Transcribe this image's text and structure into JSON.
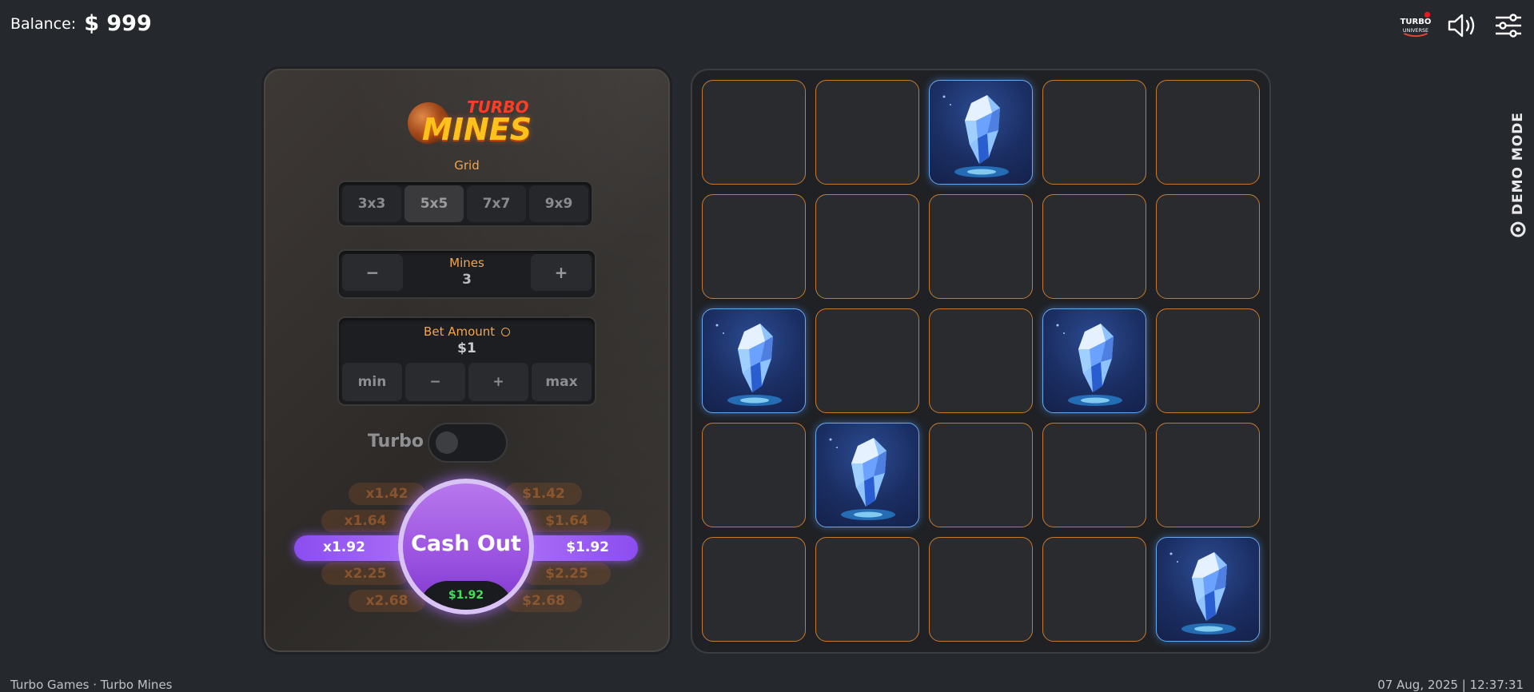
{
  "balance": {
    "label": "Balance:",
    "value": "$ 999"
  },
  "header": {
    "logo_icon": "turbo-universe-logo",
    "sound_icon": "speaker-icon",
    "settings_icon": "sliders-icon"
  },
  "demo_mode": "DEMO MODE",
  "footer": {
    "left": "Turbo Games · Turbo Mines",
    "right": "07 Aug, 2025 | 12:37:31"
  },
  "panel": {
    "logo": {
      "turbo": "TURBO",
      "mines": "MINES"
    },
    "grid": {
      "label": "Grid",
      "options": [
        "3x3",
        "5x5",
        "7x7",
        "9x9"
      ],
      "selected": "5x5"
    },
    "mines": {
      "minus": "−",
      "label": "Mines",
      "value": "3",
      "plus": "+"
    },
    "bet": {
      "label": "Bet Amount",
      "value": "$1",
      "buttons": [
        "min",
        "−",
        "+",
        "max"
      ]
    },
    "turbo": {
      "label": "Turbo",
      "enabled": false
    },
    "multipliers": {
      "ghost_rows": [
        {
          "left": "x1.42",
          "right": "$1.42"
        },
        {
          "left": "x1.64",
          "right": "$1.64"
        },
        {
          "left": "x2.25",
          "right": "$2.25"
        },
        {
          "left": "x2.68",
          "right": "$2.68"
        }
      ],
      "active": {
        "left": "x1.92",
        "right": "$1.92"
      }
    },
    "cashout": {
      "label": "Cash Out",
      "amount": "$1.92"
    }
  },
  "board": {
    "rows": 5,
    "cols": 5,
    "revealed_gems": [
      [
        0,
        2
      ],
      [
        2,
        0
      ],
      [
        2,
        3
      ],
      [
        3,
        1
      ],
      [
        4,
        4
      ]
    ],
    "tile_border_color": "#c67a2e",
    "gem_border_color": "#6aa9ec"
  }
}
